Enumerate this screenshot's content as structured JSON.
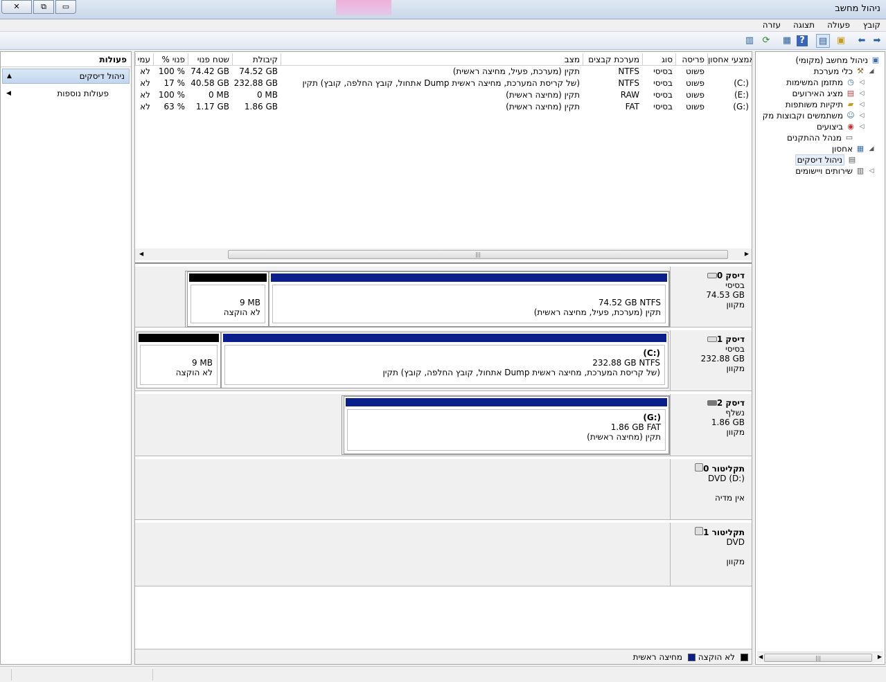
{
  "window": {
    "title": "ניהול מחשב",
    "buttons": {
      "close": "✕",
      "restore": "⧉",
      "minimize": "▭"
    }
  },
  "menu": [
    "קובץ",
    "פעולה",
    "תצוגה",
    "עזרה"
  ],
  "toolbar": {
    "icons": [
      "forward-arrow-icon",
      "back-arrow-icon",
      "folder-up-icon",
      "console-tree-icon",
      "help-icon",
      "properties-icon",
      "refresh-icon",
      "export-icon"
    ]
  },
  "nav_tree": {
    "root": "ניהול מחשב (מקומי)",
    "system_tools": "כלי מערכת",
    "task_scheduler": "מתזמן המשימות",
    "event_viewer": "מציג האירועים",
    "shared_folders": "תיקיות משותפות",
    "local_users": "משתמשים וקבוצות מק",
    "performance": "ביצועים",
    "device_manager": "מנהל ההתקנים",
    "storage": "אחסון",
    "disk_management": "ניהול דיסקים",
    "services": "שירותים ויישומים"
  },
  "actions_pane": {
    "header": "פעולות",
    "main": "ניהול דיסקים",
    "more": "פעולות נוספות"
  },
  "volume_list": {
    "columns": [
      "אמצעי אחסון",
      "פריסה",
      "סוג",
      "מערכת קבצים",
      "מצב",
      "קיבולת",
      "שטח פנוי",
      "% פנוי",
      "עמי"
    ],
    "rows": [
      {
        "vol": "",
        "layout": "פשוט",
        "type": "בסיסי",
        "fs": "NTFS",
        "status": "תקין (מערכת, פעיל, מחיצה ראשית)",
        "cap": "74.52 GB",
        "free": "74.42 GB",
        "pct": "100 %",
        "ft": "לא"
      },
      {
        "vol": "(C:)",
        "layout": "פשוט",
        "type": "בסיסי",
        "fs": "NTFS",
        "status": "תקין (אתחול, קובץ החלפה, קובץ Dump של קריסת המערכת, מחיצה ראשית)",
        "cap": "232.88 GB",
        "free": "40.58 GB",
        "pct": "17 %",
        "ft": "לא"
      },
      {
        "vol": "(E:)",
        "layout": "פשוט",
        "type": "בסיסי",
        "fs": "RAW",
        "status": "תקין (מחיצה ראשית)",
        "cap": "0 MB",
        "free": "0 MB",
        "pct": "100 %",
        "ft": "לא"
      },
      {
        "vol": "(G:)",
        "layout": "פשוט",
        "type": "בסיסי",
        "fs": "FAT",
        "status": "תקין (מחיצה ראשית)",
        "cap": "1.86 GB",
        "free": "1.17 GB",
        "pct": "63 %",
        "ft": "לא"
      }
    ],
    "scroll_grip": "|||"
  },
  "disks": {
    "d0": {
      "name": "דיסק 0",
      "kind": "בסיסי",
      "size": "74.53 GB",
      "state": "מקוון",
      "part1": {
        "title": "",
        "line1": "74.52 GB NTFS",
        "line2": "תקין (מערכת, פעיל, מחיצה ראשית)"
      },
      "unalloc": {
        "size": "9 MB",
        "label": "לא הוקצה"
      }
    },
    "d1": {
      "name": "דיסק 1",
      "kind": "בסיסי",
      "size": "232.88 GB",
      "state": "מקוון",
      "part1": {
        "title": "(C:)",
        "line1": "232.88 GB NTFS",
        "line2": "תקין (אתחול, קובץ החלפה, קובץ Dump של קריסת המערכת, מחיצה ראשית)"
      },
      "unalloc": {
        "size": "9 MB",
        "label": "לא הוקצה"
      }
    },
    "d2": {
      "name": "דיסק 2",
      "kind": "נשלף",
      "size": "1.86 GB",
      "state": "מקוון",
      "part1": {
        "title": "(G:)",
        "line1": "1.86 GB FAT",
        "line2": "תקין (מחיצה ראשית)"
      }
    },
    "cd0": {
      "name": "תקליטור 0",
      "line1": "DVD (D:)",
      "line2": "אין מדיה"
    },
    "cd1": {
      "name": "תקליטור 1",
      "line1": "DVD",
      "line2": "מקוון"
    }
  },
  "legend": {
    "unallocated": "לא הוקצה",
    "primary": "מחיצה ראשית"
  },
  "colors": {
    "primary_partition": "#0a1e8c",
    "unallocated": "#000000",
    "selection": "#c2d6ee"
  }
}
